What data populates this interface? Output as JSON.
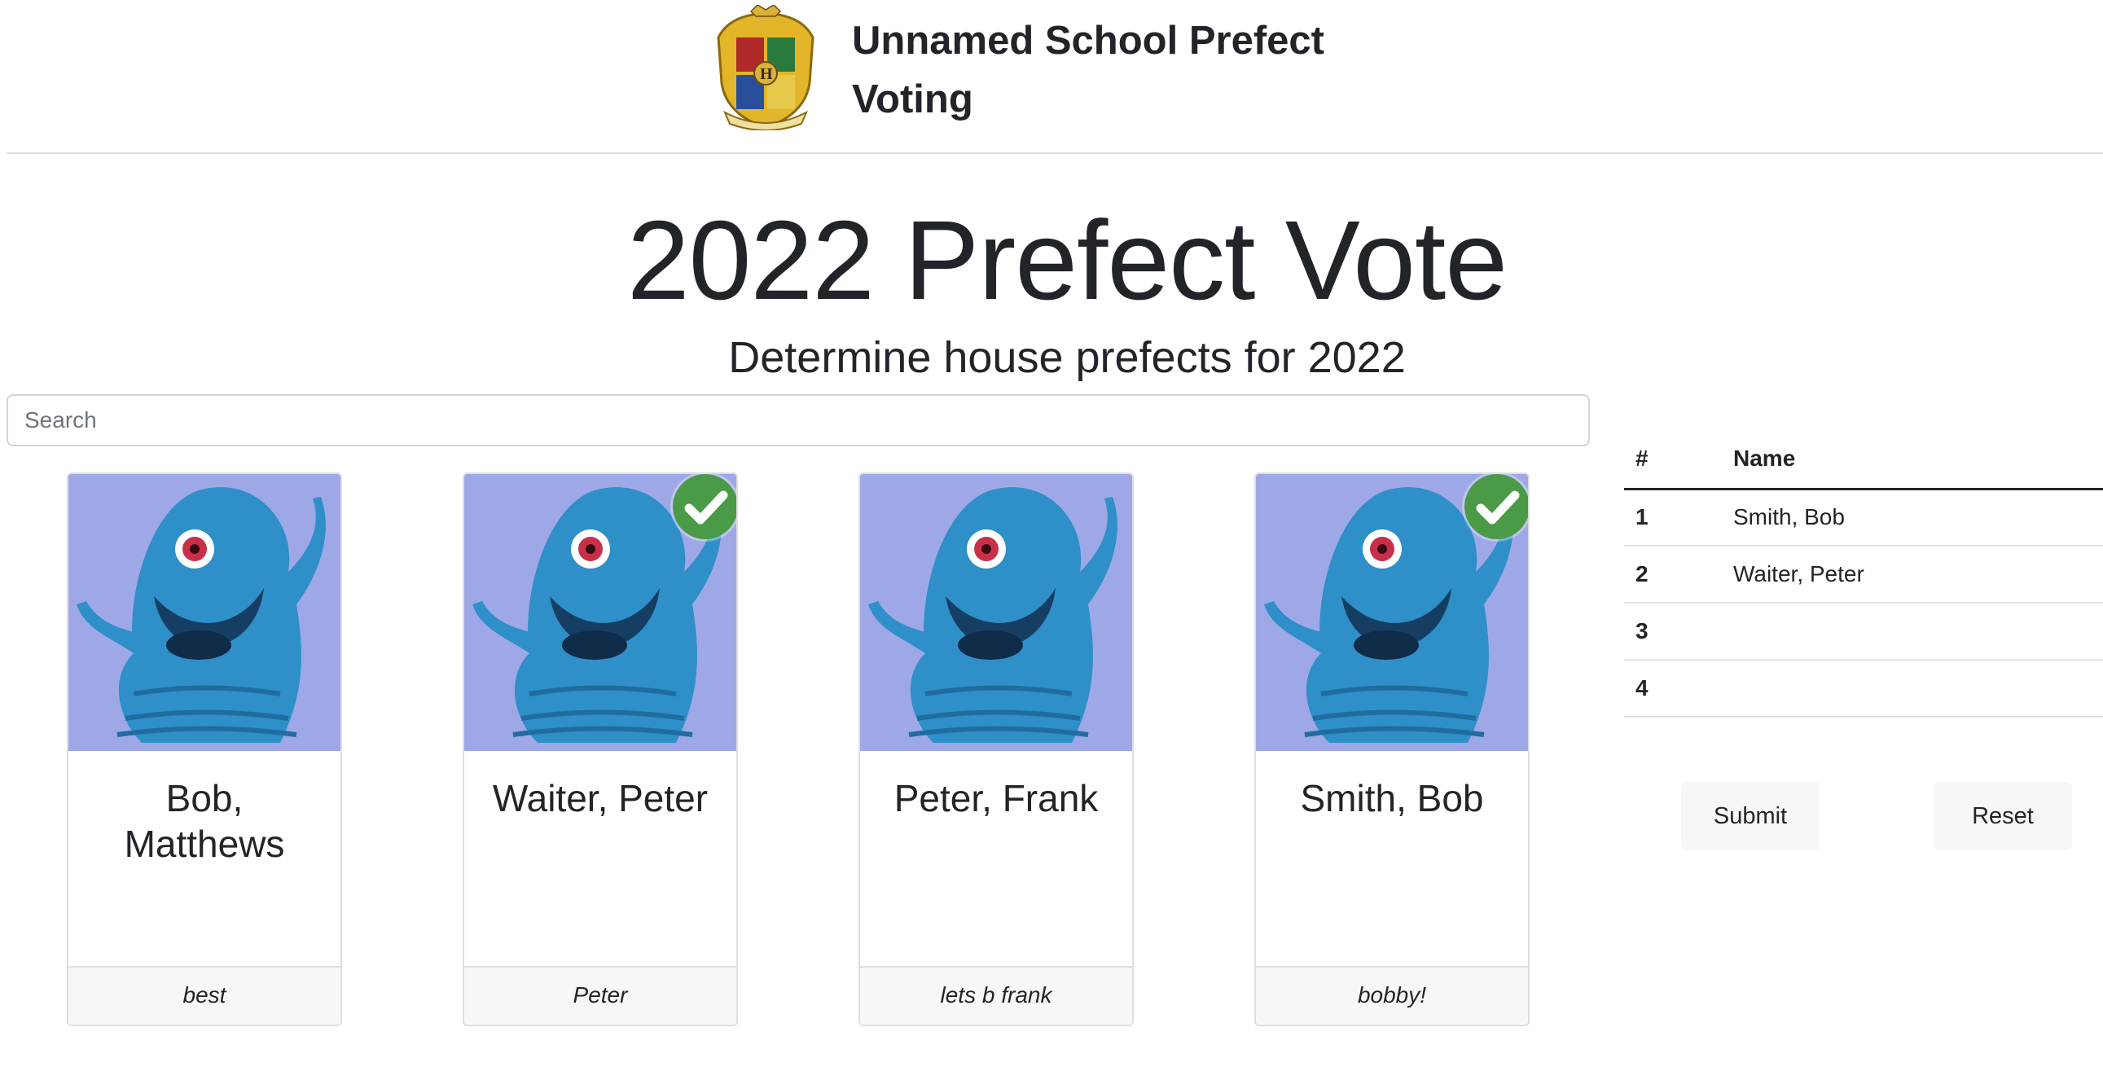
{
  "header": {
    "title": "Unnamed School Prefect Voting"
  },
  "page": {
    "title": "2022 Prefect Vote",
    "subtitle": "Determine house prefects for 2022"
  },
  "search": {
    "placeholder": "Search",
    "value": ""
  },
  "candidates": [
    {
      "name": "Bob, Matthews",
      "tagline": "best",
      "selected": false
    },
    {
      "name": "Waiter, Peter",
      "tagline": "Peter",
      "selected": true
    },
    {
      "name": "Peter, Frank",
      "tagline": "lets b frank",
      "selected": false
    },
    {
      "name": "Smith, Bob",
      "tagline": "bobby!",
      "selected": true
    }
  ],
  "ranking": {
    "headers": [
      "#",
      "Name"
    ],
    "rows": [
      {
        "num": "1",
        "name": "Smith, Bob"
      },
      {
        "num": "2",
        "name": "Waiter, Peter"
      },
      {
        "num": "3",
        "name": ""
      },
      {
        "num": "4",
        "name": ""
      }
    ]
  },
  "actions": {
    "submit_label": "Submit",
    "reset_label": "Reset"
  },
  "colors": {
    "check": "#4a9a48",
    "card_bg": "#9fa8e6",
    "creature": "#2f8fc8"
  }
}
